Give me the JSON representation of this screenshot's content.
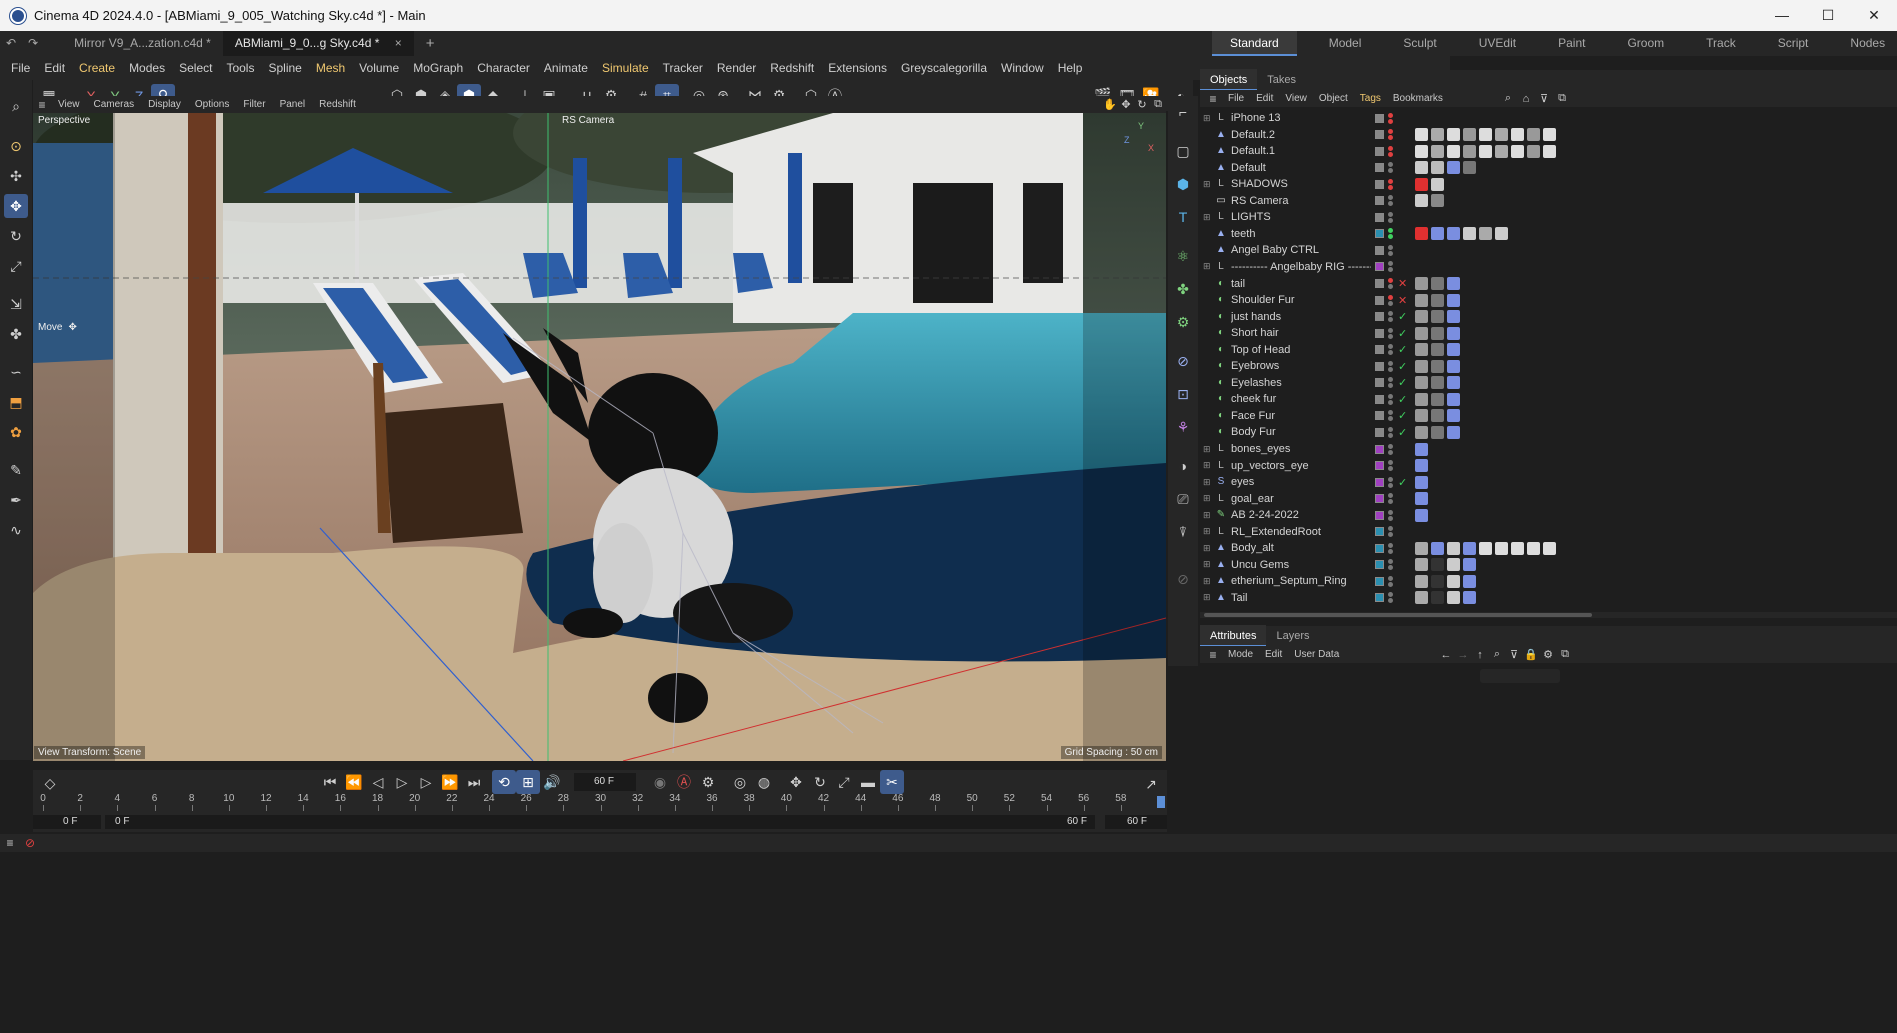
{
  "window": {
    "title": "Cinema 4D 2024.4.0 - [ABMiami_9_005_Watching Sky.c4d *] - Main",
    "min": "—",
    "max": "☐",
    "close": "✕"
  },
  "docs": {
    "undo": "↶",
    "redo": "↷",
    "tabs": [
      "Mirror V9_A...zation.c4d *",
      "ABMiami_9_0...g Sky.c4d *"
    ],
    "close": "×",
    "add": "+"
  },
  "layouts": [
    "Standard",
    "Model",
    "Sculpt",
    "UVEdit",
    "Paint",
    "Groom",
    "Track",
    "Script",
    "Nodes"
  ],
  "layout_menu": "⋮",
  "menu": [
    "File",
    "Edit",
    "Create",
    "Modes",
    "Select",
    "Tools",
    "Spline",
    "Mesh",
    "Volume",
    "MoGraph",
    "Character",
    "Animate",
    "Simulate",
    "Tracker",
    "Render",
    "Redshift",
    "Extensions",
    "Greyscalegorilla",
    "Window",
    "Help"
  ],
  "axes": {
    "x": "X",
    "y": "Y",
    "z": "Z"
  },
  "viewport_menu": [
    "View",
    "Cameras",
    "Display",
    "Options",
    "Filter",
    "Panel",
    "Redshift"
  ],
  "viewport": {
    "name": "Perspective",
    "camera": "RS Camera",
    "tool": "Move",
    "transform": "View Transform: Scene",
    "grid": "Grid Spacing : 50 cm",
    "axis_x": "X",
    "axis_y": "Y",
    "axis_z": "Z"
  },
  "objects_panel": {
    "tabs": [
      "Objects",
      "Takes"
    ],
    "menu": [
      "File",
      "Edit",
      "View",
      "Object",
      "Tags",
      "Bookmarks"
    ],
    "rows": [
      {
        "name": "iPhone 13",
        "icon": "null",
        "color": "#888"
      },
      {
        "name": "Default.2",
        "icon": "figure",
        "color": "#888"
      },
      {
        "name": "Default.1",
        "icon": "figure",
        "color": "#888"
      },
      {
        "name": "Default",
        "icon": "figure",
        "color": "#888"
      },
      {
        "name": "SHADOWS",
        "icon": "null",
        "color": "#888"
      },
      {
        "name": "RS Camera",
        "icon": "camera",
        "color": "#888"
      },
      {
        "name": "LIGHTS",
        "icon": "null",
        "color": "#888"
      },
      {
        "name": "teeth",
        "icon": "figure",
        "color": "#2b8fb0"
      },
      {
        "name": "Angel Baby CTRL",
        "icon": "figure",
        "color": "#888"
      },
      {
        "name": "---------- Angelbaby RIG ---------",
        "icon": "null",
        "color": "#a040c0"
      },
      {
        "name": "tail",
        "icon": "hair",
        "color": "#888",
        "state": "x"
      },
      {
        "name": "Shoulder Fur",
        "icon": "hair",
        "color": "#888",
        "state": "x"
      },
      {
        "name": "just hands",
        "icon": "hair",
        "color": "#888",
        "state": "v"
      },
      {
        "name": "Short hair",
        "icon": "hair",
        "color": "#888",
        "state": "v"
      },
      {
        "name": "Top of Head",
        "icon": "hair",
        "color": "#888",
        "state": "v"
      },
      {
        "name": "Eyebrows",
        "icon": "hair",
        "color": "#888",
        "state": "v"
      },
      {
        "name": "Eyelashes",
        "icon": "hair",
        "color": "#888",
        "state": "v"
      },
      {
        "name": "cheek fur",
        "icon": "hair",
        "color": "#888",
        "state": "v"
      },
      {
        "name": "Face Fur",
        "icon": "hair",
        "color": "#888",
        "state": "v"
      },
      {
        "name": "Body Fur",
        "icon": "hair",
        "color": "#888",
        "state": "v"
      },
      {
        "name": "bones_eyes",
        "icon": "null",
        "color": "#a040c0"
      },
      {
        "name": "up_vectors_eye",
        "icon": "null",
        "color": "#a040c0"
      },
      {
        "name": "eyes",
        "icon": "spline",
        "color": "#a040c0",
        "state": "v"
      },
      {
        "name": "goal_ear",
        "icon": "null",
        "color": "#a040c0"
      },
      {
        "name": "AB 2-24-2022",
        "icon": "joint",
        "color": "#a040c0"
      },
      {
        "name": "RL_ExtendedRoot",
        "icon": "null",
        "color": "#2b8fb0"
      },
      {
        "name": "Body_alt",
        "icon": "figure",
        "color": "#2b8fb0"
      },
      {
        "name": "Uncu Gems",
        "icon": "figure",
        "color": "#2b8fb0"
      },
      {
        "name": "etherium_Septum_Ring",
        "icon": "figure",
        "color": "#2b8fb0"
      },
      {
        "name": "Tail",
        "icon": "figure",
        "color": "#2b8fb0"
      }
    ]
  },
  "attributes_panel": {
    "tabs": [
      "Attributes",
      "Layers"
    ],
    "menu": [
      "Mode",
      "Edit",
      "User Data"
    ]
  },
  "timeline": {
    "frame_field": "60 F",
    "ticks": [
      0,
      2,
      4,
      6,
      8,
      10,
      12,
      14,
      16,
      18,
      20,
      22,
      24,
      26,
      28,
      30,
      32,
      34,
      36,
      38,
      40,
      42,
      44,
      46,
      48,
      50,
      52,
      54,
      56,
      58
    ],
    "start": "0 F",
    "range_start": "0 F",
    "range_end": "60 F",
    "end": "60 F"
  },
  "colors": {
    "accent": "#5c8fd6",
    "bg": "#1e1e1e",
    "panel": "#262626"
  }
}
